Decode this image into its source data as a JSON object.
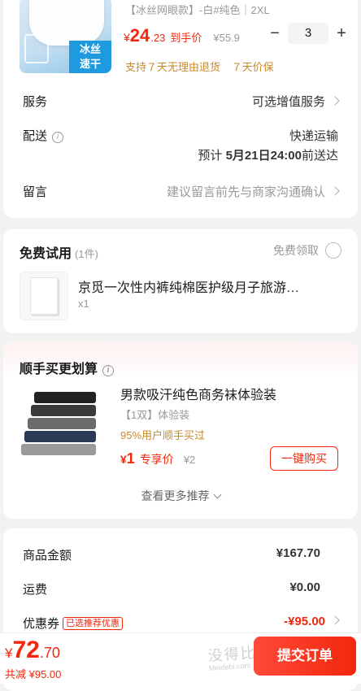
{
  "product": {
    "variant": "【冰丝网眼款】-白#纯色｜2XL",
    "thumb_badge": "冰丝\n速干",
    "price_yen": "¥",
    "price_int": "24",
    "price_dec": ".23",
    "price_tag": "到手价",
    "price_orig": "¥55.9",
    "qty_minus": "−",
    "qty": "3",
    "qty_plus": "+",
    "support": [
      "支持７天无理由退货",
      "７天价保"
    ]
  },
  "service": {
    "label": "服务",
    "value": "可选增值服务"
  },
  "delivery": {
    "label": "配送",
    "info": "i",
    "method": "快递运输",
    "eta_prefix": "预计 ",
    "eta_date": "5月21日24:00",
    "eta_suffix": "前送达"
  },
  "message": {
    "label": "留言",
    "value": "建议留言前先与商家沟通确认"
  },
  "trial": {
    "title": "免费试用",
    "count": "(1件)",
    "claim": "免费领取",
    "item_name": "京觅一次性内裤纯棉医护级月子旅游…",
    "item_qty": "x1"
  },
  "deal": {
    "title": "顺手买更划算",
    "info": "i",
    "item_name": "男款吸汗纯色商务袜体验装",
    "item_spec": "【1双】体验装",
    "item_pct": "95%用户顺手买过",
    "price_yen": "¥",
    "price": "1",
    "price_tag": "专享价",
    "price_orig": "¥2",
    "buy_label": "一键购买",
    "more_label": "查看更多推荐"
  },
  "summary": {
    "goods_label": "商品金额",
    "goods_value": "¥167.70",
    "shipping_label": "运费",
    "shipping_value": "¥0.00",
    "coupon_label": "优惠券",
    "coupon_tag": "已选推荐优惠",
    "coupon_value": "-¥95.00"
  },
  "footer": {
    "total_yen": "¥",
    "total_int": "72",
    "total_dec": ".70",
    "saved": "共减 ¥95.00",
    "submit_label": "提交订单",
    "watermark": "没得比",
    "watermark_sub": "Meidebi.com"
  },
  "colors": {
    "accent": "#f2270c",
    "gold": "#c88a2c",
    "muted": "#8c8c8c",
    "bg": "#f2f2f2"
  }
}
